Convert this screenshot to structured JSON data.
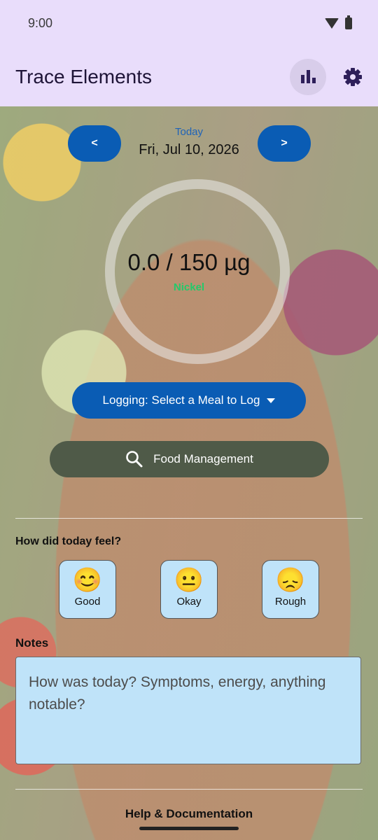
{
  "status": {
    "time": "9:00"
  },
  "appbar": {
    "title": "Trace Elements",
    "stats_icon": "bar-chart-icon",
    "settings_icon": "gear-icon"
  },
  "day_nav": {
    "prev_label": "<",
    "next_label": ">",
    "today_label": "Today",
    "date": "Fri, Jul 10, 2026"
  },
  "progress": {
    "amount_text": "0.0 / 150 µg",
    "element": "Nickel",
    "fraction": 0.0
  },
  "actions": {
    "logging_label": "Logging: Select a Meal to Log",
    "food_label": "Food Management"
  },
  "mood": {
    "question": "How did today feel?",
    "options": [
      {
        "emoji": "😊",
        "label": "Good"
      },
      {
        "emoji": "😐",
        "label": "Okay"
      },
      {
        "emoji": "😞",
        "label": "Rough"
      }
    ]
  },
  "notes": {
    "label": "Notes",
    "placeholder": "How was today? Symptoms, energy, anything notable?",
    "value": ""
  },
  "footer": {
    "help_label": "Help & Documentation"
  },
  "colors": {
    "primary": "#0a5cb4",
    "appbar": "#e9ddfb",
    "accent_green": "#23c96a",
    "mood_bg": "#bfe3f9"
  }
}
